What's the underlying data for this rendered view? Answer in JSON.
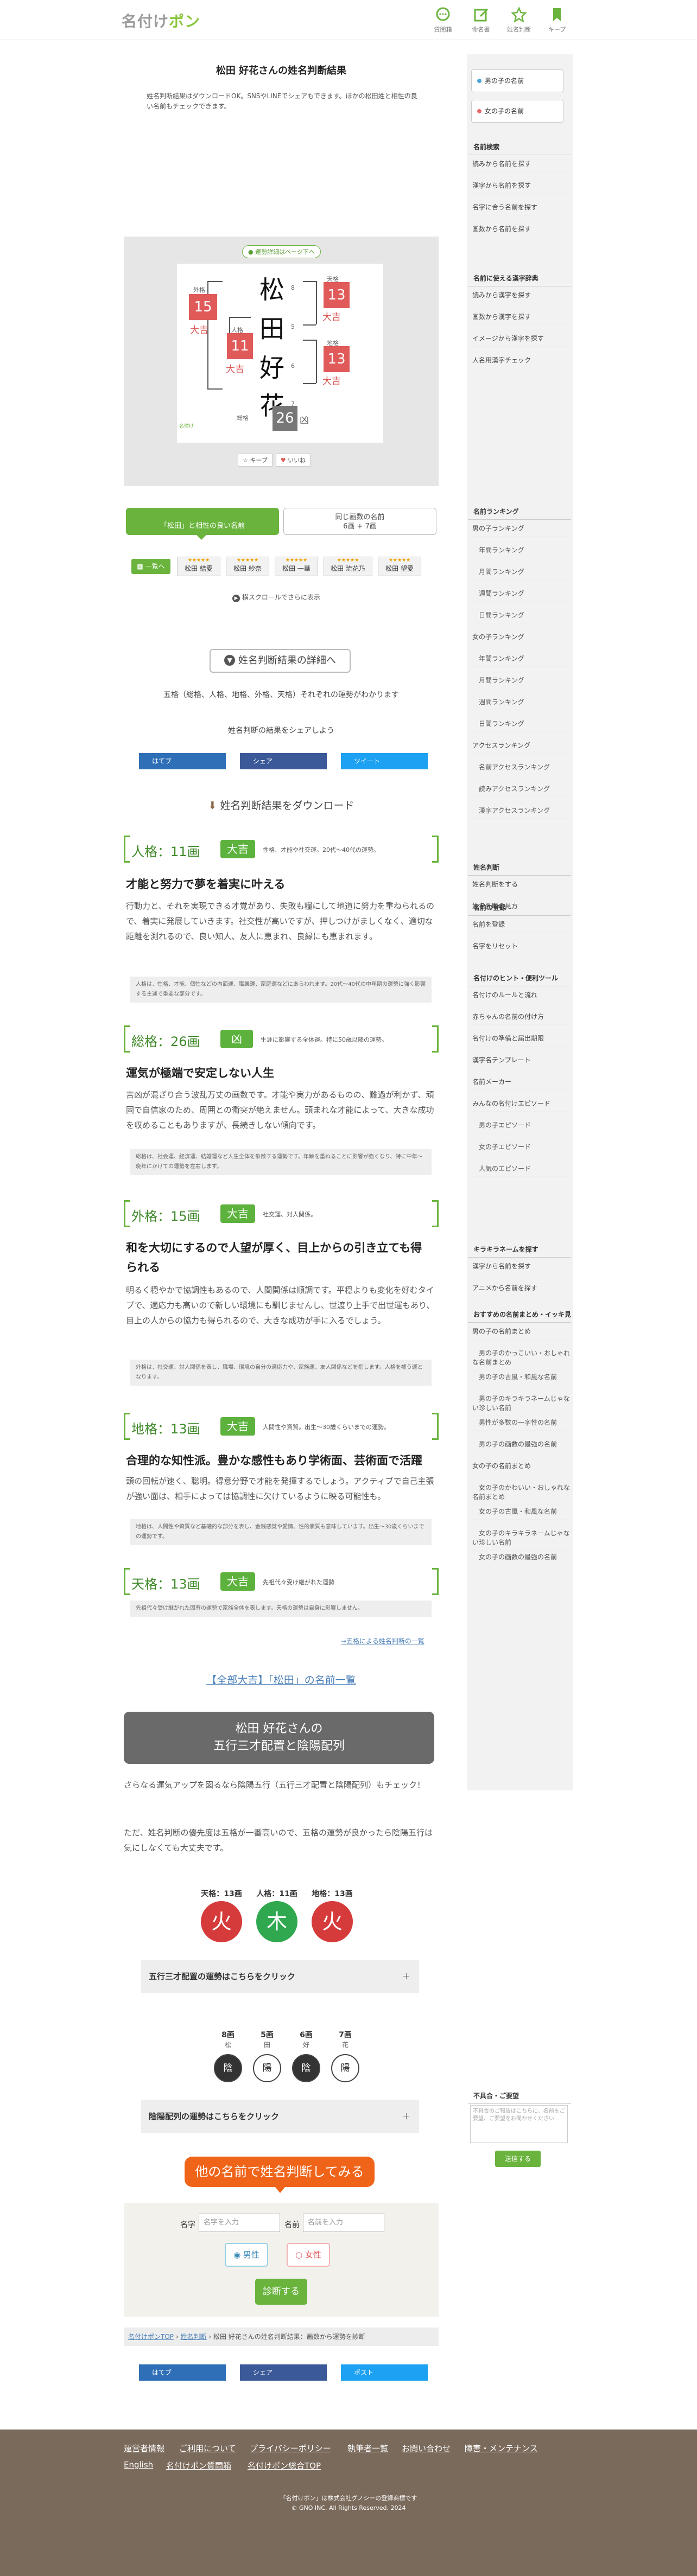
{
  "header": {
    "logo_prefix": "名付け",
    "logo_suffix": "ポン",
    "nav": [
      {
        "label": "質問箱",
        "icon": "chat-icon",
        "color": "#6ab43e"
      },
      {
        "label": "命名書",
        "icon": "edit-icon",
        "color": "#6ab43e"
      },
      {
        "label": "姓名判断",
        "icon": "star-icon",
        "color": "#6ab43e"
      },
      {
        "label": "キープ",
        "icon": "bookmark-icon",
        "color": "#6ab43e"
      }
    ]
  },
  "page": {
    "title": "松田 好花さんの姓名判断結果",
    "lead": "姓名判断結果はダウンロードOK。SNSやLINEでシェアもできます。ほかの松田姓と相性の良い名前もチェックできます。"
  },
  "card": {
    "badge": "運勢詳細はページ下へ",
    "chars": [
      "松",
      "田",
      "好",
      "花"
    ],
    "strokes": [
      "8",
      "5",
      "6",
      "7"
    ],
    "gaikaku_label": "外格",
    "gaikaku_value": "15",
    "gaikaku_luck": "大吉",
    "tenkaku_label": "天格",
    "tenkaku_value": "13",
    "tenkaku_luck": "大吉",
    "jinkaku_label": "人格",
    "jinkaku_value": "11",
    "jinkaku_luck": "大吉",
    "chikaku_label": "地格",
    "chikaku_value": "13",
    "chikaku_luck": "大吉",
    "soukaku_label": "総格",
    "soukaku_value": "26",
    "soukaku_luck": "凶",
    "keep": "キープ",
    "favorite": "いいね"
  },
  "tabs": {
    "tab1": "「松田」と相性の良い名前",
    "tab2_l1": "同じ画数の名前",
    "tab2_l2": "6画 + 7画",
    "all": "一覧へ",
    "chips": [
      "松田 結愛",
      "松田 紗奈",
      "松田 一華",
      "松田 琉花乃",
      "松田 望愛"
    ],
    "chip_stars": "★★★★★",
    "scroll_hint": "横スクロールでさらに表示"
  },
  "detail": {
    "button": "姓名判断結果の詳細へ",
    "sub": "五格（総格、人格、地格、外格、天格）それぞれの運勢がわかります",
    "share_label": "姓名判断の結果をシェアしよう",
    "share_buttons": [
      "はてブ",
      "シェア",
      "ツイート"
    ],
    "download_title": "姓名判断結果をダウンロード"
  },
  "fortunes": [
    {
      "name": "人格：11画",
      "luck": "大吉",
      "desc": "性格、才能や社交運。20代〜40代の運勢。",
      "title": "才能と努力で夢を着実に叶える",
      "body": "行動力と、それを実現できる才覚があり、失敗も糧にして地道に努力を重ねられるので、着実に発展していきます。社交性が高いですが、押しつけがましくなく、適切な距離を測れるので、良い知人、友人に恵まれ、良縁にも恵まれます。",
      "note": "人格は、性格、才能、個性などの内面運、職業運、家庭運などにあらわれます。20代〜40代の中年期の運勢に強く影響する主運で重要な部分です。"
    },
    {
      "name": "総格：26画",
      "luck": "凶",
      "desc": "生涯に影響する全体運。特に50歳以降の運勢。",
      "title": "運気が極端で安定しない人生",
      "body": "吉凶が混ざり合う波乱万丈の画数です。才能や実力があるものの、難過が利かず、頑固で自信家のため、周囲との衝突が絶えません。頭まれな才能によって、大きな成功を収めることもありますが、長続きしない傾向です。",
      "note": "総格は、社会運、経済運、結婚運など人生全体を象徴する運勢です。年齢を重ねることに影響が強くなり、特に中年〜晩年にかけての運勢を左右します。"
    },
    {
      "name": "外格：15画",
      "luck": "大吉",
      "desc": "社交運、対人関係。",
      "title": "和を大切にするので人望が厚く、目上からの引き立ても得られる",
      "body": "明るく穏やかで協調性もあるので、人間関係は順調です。平穏よりも変化を好むタイプで、適応力も高いので新しい環境にも馴じませんし、世渡り上手で出世運もあり、目上の人からの協力も得られるので、大きな成功が手に入るでしょう。",
      "note": "外格は、社交運、対人関係を表し、職場、環境の自分の適応力や、家族運、友人関係などを指します。人格を補う運となります。"
    },
    {
      "name": "地格：13画",
      "luck": "大吉",
      "desc": "人間性や資質。出生〜30歳くらいまでの運勢。",
      "title": "合理的な知性派。豊かな感性もあり学術面、芸術面で活躍",
      "body": "頭の回転が速く、聡明。得意分野で才能を発揮するでしょう。アクティブで自己主張が強い面は、相手によっては協調性に欠けているように映る可能性も。",
      "note": "地格は、人間性や資質など基礎的な部分を表し、金銭感覚や愛情、性的素質も意味しています。出生〜30歳くらいまでの運勢です。"
    },
    {
      "name": "天格：13画",
      "luck": "大吉",
      "desc": "先祖代々受け継がれた運勢",
      "title": "",
      "body": "",
      "note": "先祖代々受け継がれた固有の運勢で家族全体を表します。天格の運勢は自身に影響しません。"
    }
  ],
  "more_link": "→五格による姓名判断の一覧",
  "daikichi_link": "【全部大吉】「松田」の名前一覧",
  "gogyou": {
    "title_l1": "松田 好花さんの",
    "title_l2": "五行三才配置と陰陽配列",
    "para1": "さらなる運気アップを図るなら陰陽五行（五行三才配置と陰陽配列）もチェック！",
    "para2": "ただ、姓名判断の優先度は五格が一番高いので、五格の運勢が良かったら陰陽五行は気にしなくても大丈夫です。",
    "labels": [
      "天格：13画",
      "人格：11画",
      "地格：13画"
    ],
    "elements": [
      "火",
      "木",
      "火"
    ],
    "element_colors": [
      "#d63b3b",
      "#2fa84f",
      "#d63b3b"
    ],
    "acc1": "五行三才配置の運勢はこちらをクリック",
    "yin_strokes": [
      "8画",
      "5画",
      "6画",
      "7画"
    ],
    "yin_chars": [
      "松",
      "田",
      "好",
      "花"
    ],
    "yin_values": [
      "陰",
      "陽",
      "陰",
      "陽"
    ],
    "acc2": "陰陽配列の運勢はこちらをクリック",
    "plus": "＋"
  },
  "form": {
    "cta": "他の名前で姓名判断してみる",
    "sei_label": "名字",
    "sei_placeholder": "名字を入力",
    "mei_label": "名前",
    "mei_placeholder": "名前を入力",
    "male": "男性",
    "female": "女性",
    "submit": "診断する"
  },
  "breadcrumb": {
    "home": "名付けポンTOP",
    "sep": "›",
    "mid": "姓名判断",
    "current": "松田 好花さんの姓名判断結果：画数から運勢を診断"
  },
  "bottom_share": [
    "はてブ",
    "シェア",
    "ポスト"
  ],
  "footer": {
    "row1": [
      "運営者情報",
      "ご利用について",
      "プライバシーポリシー",
      "執筆者一覧",
      "お問い合わせ",
      "障害・メンテナンス"
    ],
    "row2": [
      "English",
      "名付けポン質問箱",
      "名付けポン総合TOP"
    ],
    "note": "「名付けポン」は株式会社グノシーの登録商標です",
    "copy": "© GNO INC. All Rights Reserved. 2024"
  },
  "sidebar": {
    "box1": "男の子の名前",
    "box2": "女の子の名前",
    "sections": [
      {
        "head": "名前検索",
        "items": [
          "読みから名前を探す",
          "漢字から名前を探す",
          "名字に合う名前を探す",
          "画数から名前を探す"
        ]
      },
      {
        "head": "名前に使える漢字辞典",
        "items": [
          "読みから漢字を探す",
          "画数から漢字を探す",
          "イメージから漢字を探す",
          "人名用漢字チェック"
        ]
      },
      {
        "head": "名前ランキング",
        "items": [
          "男の子ランキング",
          "　年間ランキング",
          "　月間ランキング",
          "　週間ランキング",
          "　日間ランキング",
          "女の子ランキング",
          "　年間ランキング",
          "　月間ランキング",
          "　週間ランキング",
          "　日間ランキング",
          "アクセスランキング",
          "　名前アクセスランキング",
          "　読みアクセスランキング",
          "　漢字アクセスランキング"
        ]
      },
      {
        "head": "姓名判断",
        "items": [
          "姓名判断をする",
          "姓名判断の見方"
        ]
      },
      {
        "head": "名前の登録",
        "items": [
          "名前を登録",
          "名字をリセット"
        ]
      },
      {
        "head": "名付けのヒント・便利ツール",
        "items": [
          "名付けのルールと流れ",
          "赤ちゃんの名前の付け方",
          "名付けの準備と届出期限",
          "漢字名テンプレート",
          "名前メーカー",
          "みんなの名付けエピソード",
          "　男の子エピソード",
          "　女の子エピソード",
          "　人気のエピソード"
        ]
      },
      {
        "head": "キラキラネームを探す",
        "items": [
          "漢字から名前を探す",
          "アニメから名前を探す"
        ]
      },
      {
        "head": "おすすめの名前まとめ・イッキ見",
        "items": [
          "男の子の名前まとめ",
          "　男の子のかっこいい・おしゃれな名前まとめ",
          "　男の子の古風・和風な名前",
          "　男の子のキラキラネームじゃない珍しい名前",
          "　男性が多数の一字性の名前",
          "　男の子の画数の最強の名前",
          "女の子の名前まとめ",
          "　女の子のかわいい・おしゃれな名前まとめ",
          "　女の子の古風・和風な名前",
          "　女の子のキラキラネームじゃない珍しい名前",
          "　女の子の画数の最強の名前"
        ]
      },
      {
        "head": "不具合・ご要望",
        "items": []
      }
    ],
    "feedback_placeholder": "不具合のご報告はこちらに、名前をご要望、ご要望をお聞かせください…",
    "feedback_submit": "送信する"
  }
}
